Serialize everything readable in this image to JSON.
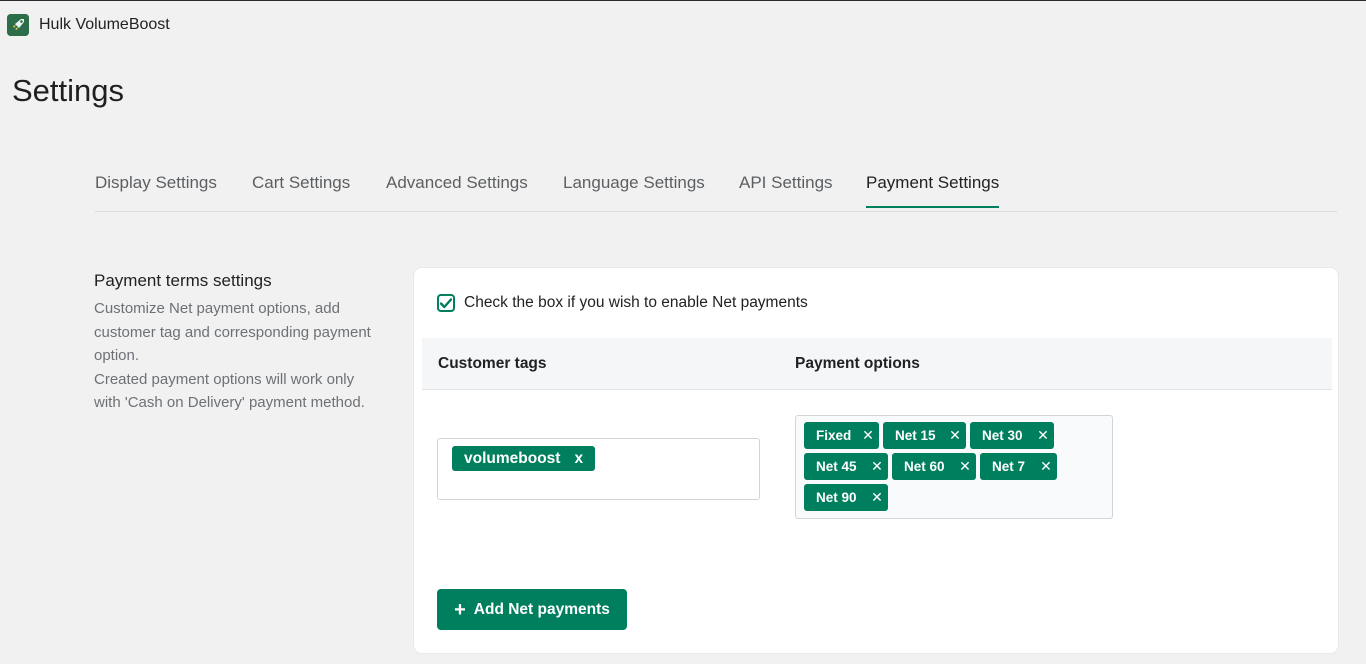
{
  "app": {
    "title": "Hulk VolumeBoost"
  },
  "page": {
    "title": "Settings"
  },
  "tabs": [
    {
      "label": "Display Settings",
      "active": false
    },
    {
      "label": "Cart Settings",
      "active": false
    },
    {
      "label": "Advanced Settings",
      "active": false
    },
    {
      "label": "Language Settings",
      "active": false
    },
    {
      "label": "API Settings",
      "active": false
    },
    {
      "label": "Payment Settings",
      "active": true
    }
  ],
  "section": {
    "heading": "Payment terms settings",
    "description_1": "Customize Net payment options, add customer tag and corresponding payment option.",
    "description_2": "Created payment options will work only with 'Cash on Delivery' payment method."
  },
  "net_payments": {
    "enabled": true,
    "checkbox_label": "Check the box if you wish to enable Net payments",
    "table_headers": {
      "customer_tags": "Customer tags",
      "payment_options": "Payment options"
    },
    "customer_tags": [
      {
        "label": "volumeboost",
        "remove": "x"
      }
    ],
    "payment_options": [
      {
        "label": "Fixed",
        "remove": "✕"
      },
      {
        "label": "Net 15",
        "remove": "✕"
      },
      {
        "label": "Net 30",
        "remove": "✕"
      },
      {
        "label": "Net 45",
        "remove": "✕"
      },
      {
        "label": "Net 60",
        "remove": "✕"
      },
      {
        "label": "Net 7",
        "remove": "✕"
      },
      {
        "label": "Net 90",
        "remove": "✕"
      }
    ],
    "add_button_label": "Add Net payments",
    "add_icon": "+"
  },
  "colors": {
    "accent": "#007f5f",
    "background": "#f1f1f1",
    "card": "#ffffff"
  },
  "icons": {
    "app_logo": "rocket-logo-icon",
    "checkbox": "checkmark-icon",
    "add": "plus-icon",
    "remove": "close-icon"
  }
}
